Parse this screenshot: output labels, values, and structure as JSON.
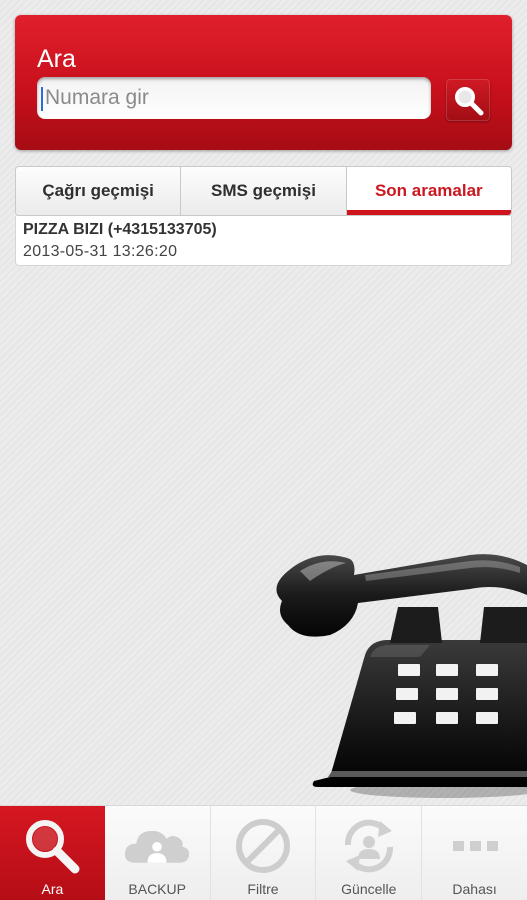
{
  "search": {
    "title": "Ara",
    "placeholder": "Numara gir",
    "button_icon": "search-icon"
  },
  "tabs": [
    {
      "label": "Çağrı geçmişi",
      "active": false
    },
    {
      "label": "SMS geçmişi",
      "active": false
    },
    {
      "label": "Son aramalar",
      "active": true
    }
  ],
  "recent_calls": [
    {
      "name": "PIZZA BIZI (+4315133705)",
      "datetime": "2013-05-31 13:26:20"
    }
  ],
  "illustration": {
    "icon": "telephone-illustration"
  },
  "bottom_nav": [
    {
      "label": "Ara",
      "icon": "search-icon",
      "active": true
    },
    {
      "label": "BACKUP",
      "icon": "cloud-user-icon",
      "active": false
    },
    {
      "label": "Filtre",
      "icon": "block-icon",
      "active": false
    },
    {
      "label": "Güncelle",
      "icon": "refresh-user-icon",
      "active": false
    },
    {
      "label": "Dahası",
      "icon": "more-icon",
      "active": false
    }
  ],
  "colors": {
    "accent": "#d0141e",
    "accent_dark": "#a60c14"
  }
}
